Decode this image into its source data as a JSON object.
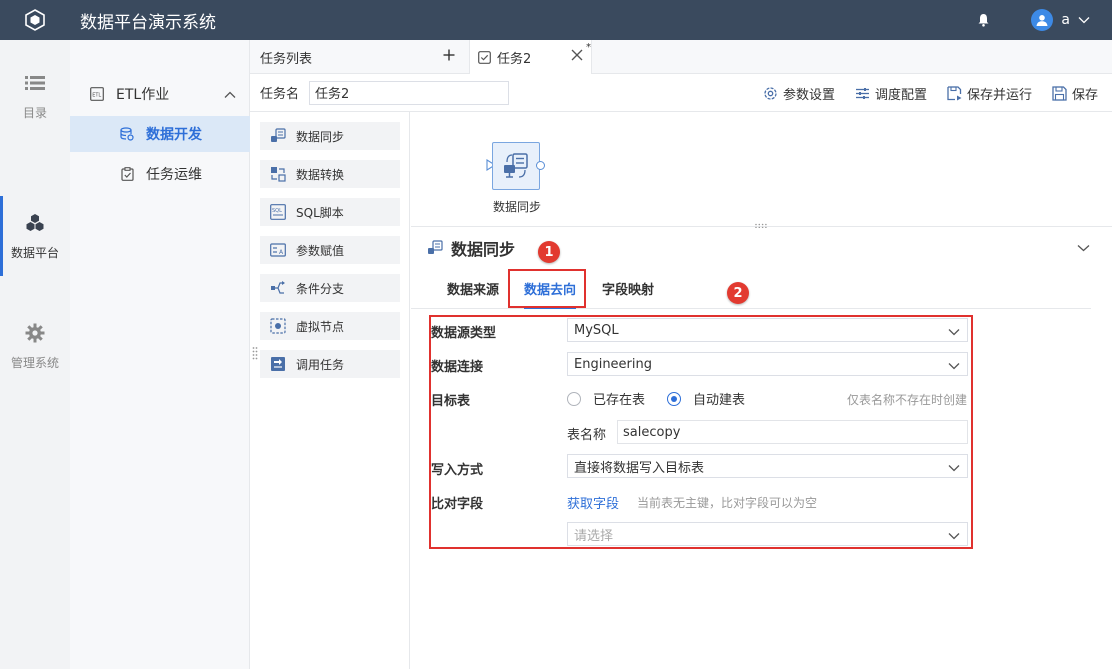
{
  "topbar": {
    "app_title": "数据平台演示系统",
    "user_name": "a"
  },
  "rail": {
    "items": [
      {
        "label": "目录",
        "icon": "list-icon"
      },
      {
        "label": "数据平台",
        "icon": "cubes-icon",
        "active": true
      },
      {
        "label": "管理系统",
        "icon": "gear-icon"
      }
    ]
  },
  "sidebar": {
    "group": "ETL作业",
    "items": [
      {
        "label": "数据开发",
        "active": true
      },
      {
        "label": "任务运维"
      }
    ]
  },
  "tabs": {
    "list_label": "任务列表",
    "active_tab": "任务2",
    "modified_mark": "*"
  },
  "toolbar": {
    "task_name_label": "任务名",
    "task_name_value": "任务2",
    "actions": [
      "参数设置",
      "调度配置",
      "保存并运行",
      "保存"
    ]
  },
  "palette": {
    "items": [
      "数据同步",
      "数据转换",
      "SQL脚本",
      "参数赋值",
      "条件分支",
      "虚拟节点",
      "调用任务"
    ]
  },
  "canvas": {
    "node_label": "数据同步"
  },
  "panel": {
    "title": "数据同步",
    "tabs": [
      "数据来源",
      "数据去向",
      "字段映射"
    ],
    "active_tab_index": 1,
    "badges": [
      "1",
      "2"
    ],
    "form": {
      "source_type_label": "数据源类型",
      "source_type_value": "MySQL",
      "connection_label": "数据连接",
      "connection_value": "Engineering",
      "target_label": "目标表",
      "radio_existing": "已存在表",
      "radio_auto": "自动建表",
      "radio_selected": "自动建表",
      "target_hint": "仅表名称不存在时创建",
      "table_name_label": "表名称",
      "table_name_value": "salecopy",
      "write_mode_label": "写入方式",
      "write_mode_value": "直接将数据写入目标表",
      "compare_label": "比对字段",
      "fetch_fields_link": "获取字段",
      "compare_hint": "当前表无主键，比对字段可以为空",
      "compare_placeholder": "请选择"
    }
  },
  "colors": {
    "topbar": "#3a4a5e",
    "accent": "#2e6fd8",
    "annotation": "#e0312e"
  }
}
